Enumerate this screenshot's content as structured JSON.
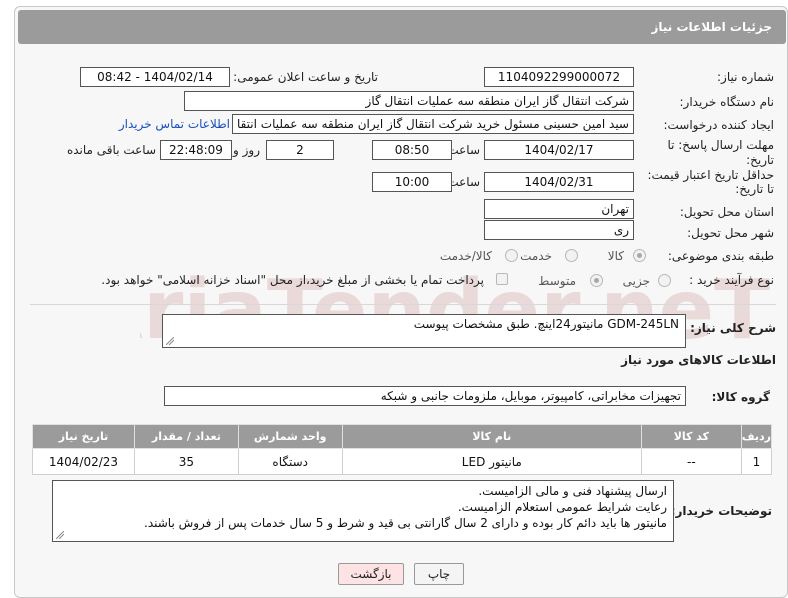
{
  "header": {
    "title": "جزئیات اطلاعات نیاز"
  },
  "fields": {
    "need_number_label": "شماره نیاز:",
    "need_number": "1104092299000072",
    "announce_label": "تاریخ و ساعت اعلان عمومی:",
    "announce_value": "1404/02/14 - 08:42",
    "buyer_label": "نام دستگاه خریدار:",
    "buyer_value": "شرکت انتقال گاز ایران منطقه سه عملیات انتقال گاز",
    "creator_label": "ایجاد کننده درخواست:",
    "creator_value": "سید امین حسینی مسئول خرید شرکت انتقال گاز ایران منطقه سه عملیات انتقا",
    "contact_link": "اطلاعات تماس خریدار",
    "deadline_label_1": "مهلت ارسال پاسخ: تا",
    "deadline_label_2": "تاریخ:",
    "deadline_date": "1404/02/17",
    "time_label": "ساعت",
    "deadline_time": "08:50",
    "days_value": "2",
    "days_label": "روز و",
    "remaining_time": "22:48:09",
    "remaining_label": "ساعت باقی مانده",
    "validity_label_1": "حداقل تاریخ اعتبار قیمت:",
    "validity_label_2": "تا تاریخ:",
    "validity_date": "1404/02/31",
    "validity_time": "10:00",
    "province_label": "استان محل تحویل:",
    "province_value": "تهران",
    "city_label": "شهر محل تحویل:",
    "city_value": "ری",
    "category_label": "طبقه بندی موضوعی:",
    "category_options": [
      "کالا",
      "خدمت",
      "کالا/خدمت"
    ],
    "purchase_label": "نوع فرآیند خرید :",
    "purchase_options": [
      "جزیی",
      "متوسط"
    ],
    "payment_note": "پرداخت تمام یا بخشی از مبلغ خرید،از محل \"اسناد خزانه اسلامی\" خواهد بود."
  },
  "description": {
    "label": "شرح کلی نیاز:",
    "text": "GDM-245LN مانیتور24اینچ. طبق مشخصات پیوست"
  },
  "goods": {
    "section_title": "اطلاعات کالاهای مورد نیاز",
    "group_label": "گروه کالا:",
    "group_value": "تجهیزات مخابراتی، کامپیوتر، موبایل، ملزومات جانبی و شبکه",
    "columns": [
      "ردیف",
      "کد کالا",
      "نام کالا",
      "واحد شمارش",
      "تعداد / مقدار",
      "تاریخ نیاز"
    ],
    "rows": [
      [
        "1",
        "--",
        "مانیتور LED",
        "دستگاه",
        "35",
        "1404/02/23"
      ]
    ]
  },
  "buyer_notes": {
    "label": "توضیحات خریدار:",
    "lines": [
      "ارسال پیشنهاد فنی و مالی الزامیست.",
      "رعایت شرایط عمومی استعلام الزامیست.",
      "مانیتور ها باید دائم کار بوده و دارای 2 سال گارانتی بی قید و شرط و 5 سال خدمات پس از فروش باشند."
    ]
  },
  "buttons": {
    "print": "چاپ",
    "back": "بازگشت"
  },
  "watermark": {
    "text": "AriaTender.neT"
  },
  "colors": {
    "header_bg": "#9b9b9b",
    "link": "#1a4fc0",
    "back_button_bg": "#fde3e3"
  }
}
